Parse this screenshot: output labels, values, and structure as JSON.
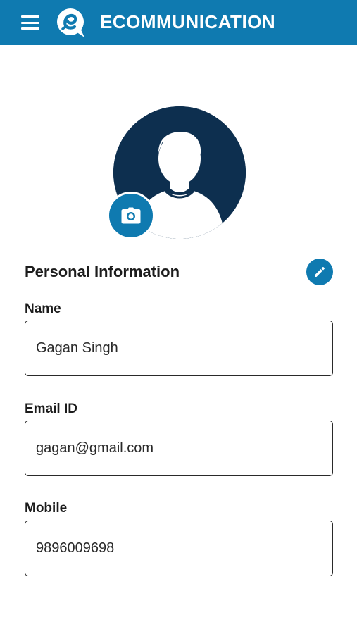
{
  "appbar": {
    "title": "ECOMMUNICATION",
    "menu_icon": "hamburger-menu-icon",
    "logo_icon": "ecommunication-logo-icon",
    "background_color": "#0f7ab0"
  },
  "profile": {
    "avatar_icon": "user-silhouette-icon",
    "camera_icon": "camera-icon",
    "avatar_color": "#0d2f4f"
  },
  "personal_info": {
    "title": "Personal Information",
    "edit_icon": "pencil-icon"
  },
  "fields": {
    "name": {
      "label": "Name",
      "value": "Gagan Singh"
    },
    "email": {
      "label": "Email ID",
      "value": "gagan@gmail.com"
    },
    "mobile": {
      "label": "Mobile",
      "value": "9896009698"
    }
  }
}
